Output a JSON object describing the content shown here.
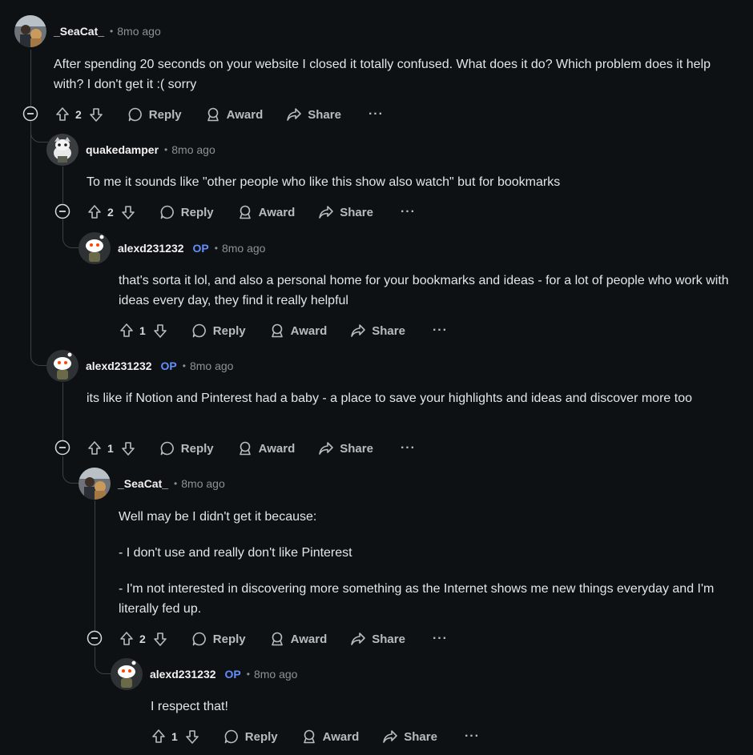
{
  "actions": {
    "reply_label": "Reply",
    "award_label": "Award",
    "share_label": "Share",
    "more_label": "···"
  },
  "comments": [
    {
      "username": "_SeaCat_",
      "op_badge": "",
      "time": "8mo ago",
      "body": "After spending 20 seconds on your website I closed it totally confused. What does it do? Which problem does it help with? I don't get it :( sorry",
      "votes": "2",
      "avatar": "photo-avatar"
    },
    {
      "username": "quakedamper",
      "op_badge": "",
      "time": "8mo ago",
      "body": "To me it sounds like \"other people who like this show also watch\" but for bookmarks",
      "votes": "2",
      "avatar": "snoo-avatar"
    },
    {
      "username": "alexd231232",
      "op_badge": "OP",
      "time": "8mo ago",
      "body": "that's sorta it lol, and also a personal home for your bookmarks and ideas - for a lot of people who work with ideas every day, they find it really helpful",
      "votes": "1",
      "avatar": "snoo-avatar"
    },
    {
      "username": "alexd231232",
      "op_badge": "OP",
      "time": "8mo ago",
      "body": "its like if Notion and Pinterest had a baby - a place to save your highlights and ideas and discover more too",
      "votes": "1",
      "avatar": "snoo-avatar"
    },
    {
      "username": "_SeaCat_",
      "op_badge": "",
      "time": "8mo ago",
      "body_paragraphs": [
        "Well may be I didn't get it because:",
        "- I don't use and really don't like Pinterest",
        "- I'm not interested in discovering more something as the Internet shows me new things everyday and I'm literally fed up."
      ],
      "votes": "2",
      "avatar": "photo-avatar"
    },
    {
      "username": "alexd231232",
      "op_badge": "OP",
      "time": "8mo ago",
      "body": "I respect that!",
      "votes": "1",
      "avatar": "snoo-avatar"
    }
  ],
  "separator": "•",
  "colors": {
    "background": "#0e1113",
    "op_accent": "#648efc",
    "thread_line": "#3e4142"
  }
}
